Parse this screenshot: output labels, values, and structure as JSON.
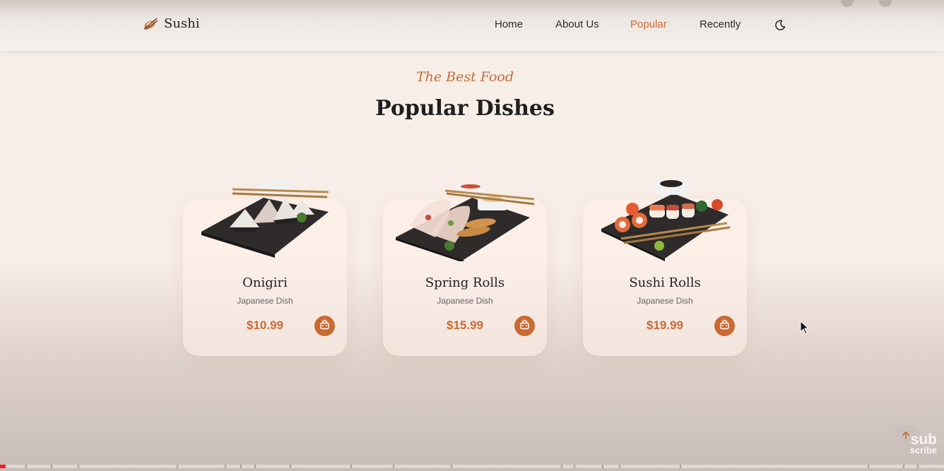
{
  "header": {
    "brand": "Sushi",
    "nav": [
      {
        "label": "Home",
        "active": false
      },
      {
        "label": "About Us",
        "active": false
      },
      {
        "label": "Popular",
        "active": true
      },
      {
        "label": "Recently",
        "active": false
      }
    ],
    "theme_icon": "moon-icon"
  },
  "section": {
    "subtitle": "The Best Food",
    "title": "Popular Dishes"
  },
  "dishes": [
    {
      "name": "Onigiri",
      "category": "Japanese Dish",
      "price": "$10.99",
      "image_icon": "onigiri-plate-image"
    },
    {
      "name": "Spring Rolls",
      "category": "Japanese Dish",
      "price": "$15.99",
      "image_icon": "spring-rolls-plate-image"
    },
    {
      "name": "Sushi Rolls",
      "category": "Japanese Dish",
      "price": "$19.99",
      "image_icon": "sushi-rolls-plate-image"
    }
  ],
  "colors": {
    "accent": "#c96a33",
    "text": "#1f1f1f",
    "background": "#f8ede7"
  },
  "scroll_up_icon": "arrow-up-icon",
  "watermark": {
    "line1": "sub",
    "line2": "scribe"
  },
  "video_progress": 0.006
}
